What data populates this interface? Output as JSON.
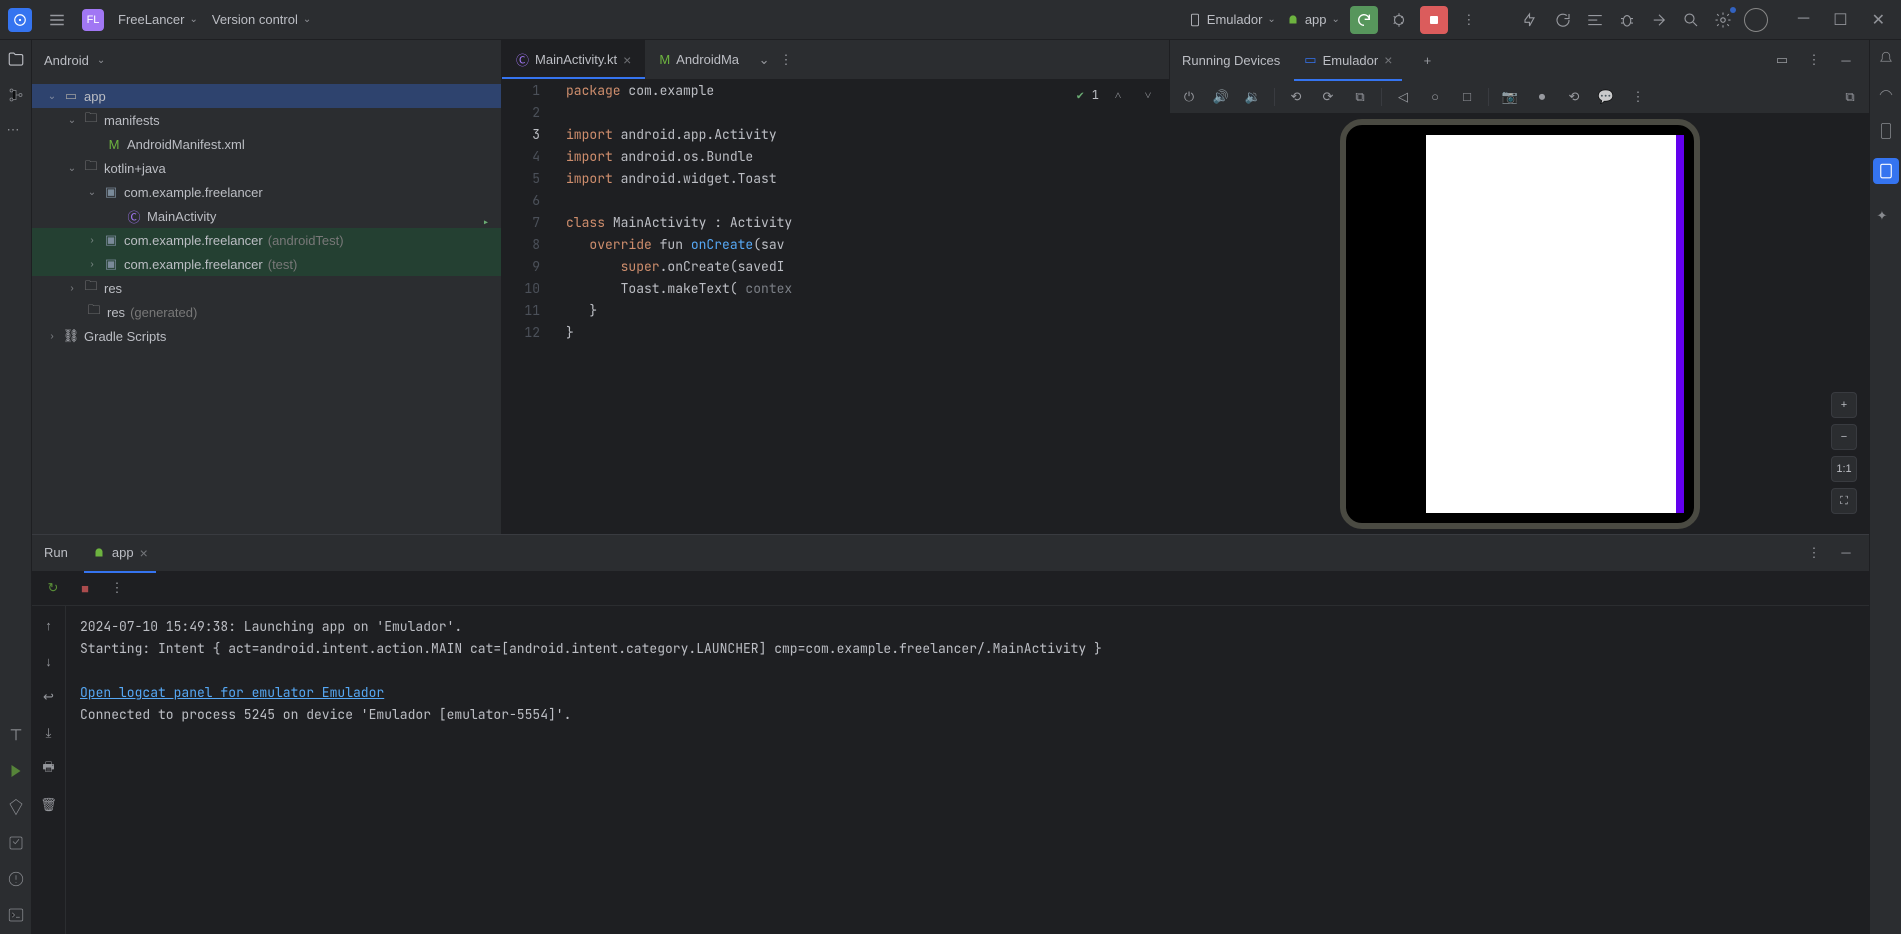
{
  "titlebar": {
    "project_badge": "FL",
    "project_name": "FreeLancer",
    "vcs_label": "Version control",
    "device_label": "Emulador",
    "run_config": "app"
  },
  "project_panel": {
    "view_mode": "Android",
    "tree": {
      "app": "app",
      "manifests": "manifests",
      "manifest_file": "AndroidManifest.xml",
      "kotlin_java": "kotlin+java",
      "pkg": "com.example.freelancer",
      "main_activity": "MainActivity",
      "pkg_android_test": "com.example.freelancer",
      "android_test_suffix": "(androidTest)",
      "pkg_test": "com.example.freelancer",
      "test_suffix": "(test)",
      "res": "res",
      "res_gen": "res",
      "res_gen_suffix": "(generated)",
      "gradle": "Gradle Scripts"
    }
  },
  "editor": {
    "tab1": "MainActivity.kt",
    "tab2": "AndroidMa",
    "problems_count": "1",
    "lines": {
      "l1a": "package",
      "l1b": " com.example",
      "l3a": "import",
      "l3b": " android.app.Activity",
      "l4a": "import",
      "l4b": " android.os.Bundle",
      "l5a": "import",
      "l5b": " android.widget.Toast",
      "l7a": "class",
      "l7b": " MainActivity : Activity",
      "l8a": "override",
      "l8b": " fun ",
      "l8c": "onCreate",
      "l8d": "(sav",
      "l9a": "super",
      "l9b": ".onCreate(savedI",
      "l10a": "Toast.makeText( ",
      "l10b": "contex",
      "l11": "}",
      "l12": "}"
    }
  },
  "running_devices": {
    "title": "Running Devices",
    "tab": "Emulador",
    "zoom_fit": "1:1"
  },
  "run_panel": {
    "title": "Run",
    "tab": "app",
    "console": {
      "line1": "2024-07-10 15:49:38: Launching app on 'Emulador'.",
      "line2": "Starting: Intent { act=android.intent.action.MAIN cat=[android.intent.category.LAUNCHER] cmp=com.example.freelancer/.MainActivity }",
      "line3_link": "Open logcat panel for emulator Emulador",
      "line4": "Connected to process 5245 on device 'Emulador [emulator-5554]'."
    }
  }
}
